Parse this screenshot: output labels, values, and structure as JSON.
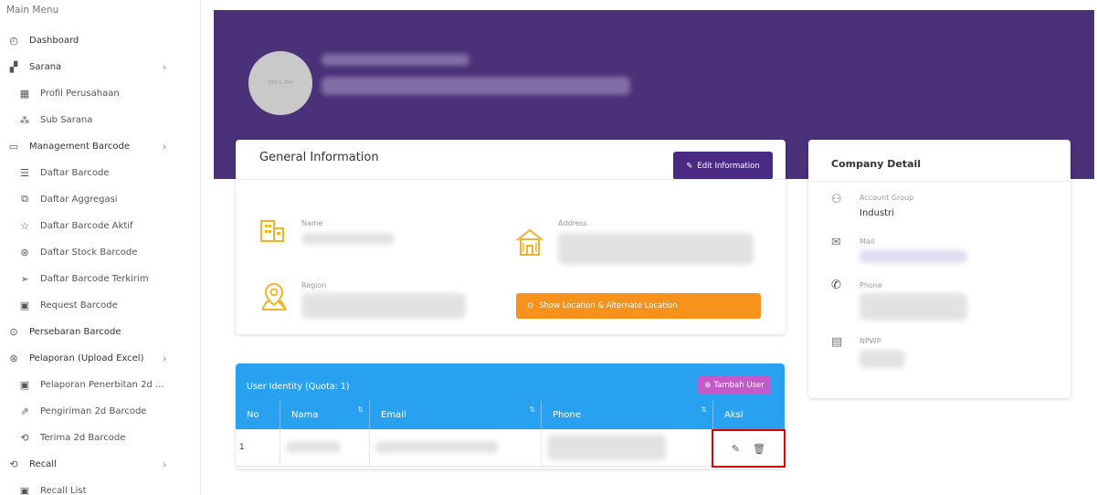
{
  "sidebar": {
    "menu_title": "Main Menu",
    "items": [
      {
        "label": "Dashboard",
        "icon": "dashboard-icon",
        "glyph": "◴",
        "level": "top",
        "chevron": ""
      },
      {
        "label": "Sarana",
        "icon": "sarana-icon",
        "glyph": "▞",
        "level": "top",
        "chevron": "›"
      },
      {
        "label": "Profil Perusahaan",
        "icon": "building-icon",
        "glyph": "▦",
        "level": "sub",
        "chevron": ""
      },
      {
        "label": "Sub Sarana",
        "icon": "network-icon",
        "glyph": "⁂",
        "level": "sub",
        "chevron": ""
      },
      {
        "label": "Management Barcode",
        "icon": "calendar-icon",
        "glyph": "▭",
        "level": "top",
        "chevron": "›"
      },
      {
        "label": "Daftar Barcode",
        "icon": "list-icon",
        "glyph": "☰",
        "level": "sub",
        "chevron": ""
      },
      {
        "label": "Daftar Aggregasi",
        "icon": "stack-icon",
        "glyph": "⧉",
        "level": "sub",
        "chevron": ""
      },
      {
        "label": "Daftar Barcode Aktif",
        "icon": "star-icon",
        "glyph": "☆",
        "level": "sub",
        "chevron": ""
      },
      {
        "label": "Daftar Stock Barcode",
        "icon": "box-icon",
        "glyph": "⊛",
        "level": "sub",
        "chevron": ""
      },
      {
        "label": "Daftar Barcode Terkirim",
        "icon": "send-icon",
        "glyph": "➢",
        "level": "sub",
        "chevron": ""
      },
      {
        "label": "Request Barcode",
        "icon": "monitor-icon",
        "glyph": "▣",
        "level": "sub",
        "chevron": ""
      },
      {
        "label": "Persebaran Barcode",
        "icon": "location-icon",
        "glyph": "⊙",
        "level": "top",
        "chevron": ""
      },
      {
        "label": "Pelaporan (Upload Excel)",
        "icon": "report-icon",
        "glyph": "⊛",
        "level": "top",
        "chevron": "›"
      },
      {
        "label": "Pelaporan Penerbitan 2d ...",
        "icon": "monitor-icon",
        "glyph": "▣",
        "level": "sub",
        "chevron": ""
      },
      {
        "label": "Pengiriman 2d Barcode",
        "icon": "shipping-icon",
        "glyph": "⇗",
        "level": "sub",
        "chevron": ""
      },
      {
        "label": "Terima 2d Barcode",
        "icon": "receive-icon",
        "glyph": "⟲",
        "level": "sub",
        "chevron": ""
      },
      {
        "label": "Recall",
        "icon": "recall-icon",
        "glyph": "⟲",
        "level": "top",
        "chevron": "›"
      },
      {
        "label": "Recall List",
        "icon": "monitor-icon",
        "glyph": "▣",
        "level": "sub",
        "chevron": ""
      }
    ]
  },
  "profile": {
    "avatar_placeholder": "150 x 150"
  },
  "general_info": {
    "title": "General Information",
    "edit_button": "Edit Information",
    "name_label": "Name",
    "address_label": "Address",
    "region_label": "Region",
    "location_button": "Show Location & Alternate Location"
  },
  "company_detail": {
    "title": "Company Detail",
    "account_group_label": "Account Group",
    "account_group_value": "Industri",
    "mail_label": "Mail",
    "phone_label": "Phone",
    "npwp_label": "NPWP"
  },
  "user_table": {
    "title": "User Identity (Quota: 1)",
    "add_button": "Tambah User",
    "columns": [
      "No",
      "Nama",
      "Email",
      "Phone",
      "Aksi"
    ],
    "rows": [
      {
        "no": "1"
      }
    ]
  },
  "colors": {
    "banner": "#4a3178",
    "edit_button": "#4a2a82",
    "location_button": "#f7921d",
    "table_header": "#29a1f1",
    "add_button": "#c35ac9",
    "highlight": "#d60000"
  }
}
